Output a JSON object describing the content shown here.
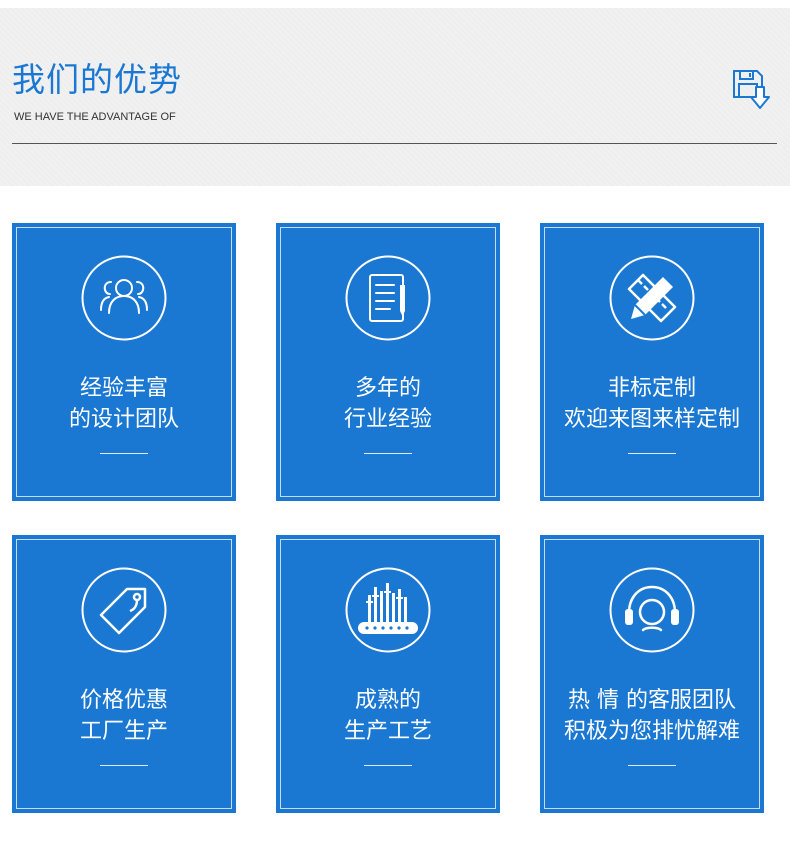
{
  "colors": {
    "accent": "#1a78d3",
    "header_background": "#f1f1f1"
  },
  "header": {
    "title": "我们的优势",
    "subtitle": "WE HAVE THE ADVANTAGE OF",
    "icon": "download-icon"
  },
  "cards": [
    {
      "icon": "team-icon",
      "line1": "经验丰富",
      "line2": "的设计团队"
    },
    {
      "icon": "document-icon",
      "line1": "多年的",
      "line2": "行业经验"
    },
    {
      "icon": "pencil-ruler-icon",
      "line1": "非标定制",
      "line2": "欢迎来图来样定制"
    },
    {
      "icon": "price-tag-icon",
      "line1": "价格优惠",
      "line2": "工厂生产"
    },
    {
      "icon": "factory-icon",
      "line1": "成熟的",
      "line2": "生产工艺"
    },
    {
      "icon": "headset-icon",
      "line1": "热 情 的客服团队",
      "line2": "积极为您排忧解难"
    }
  ]
}
